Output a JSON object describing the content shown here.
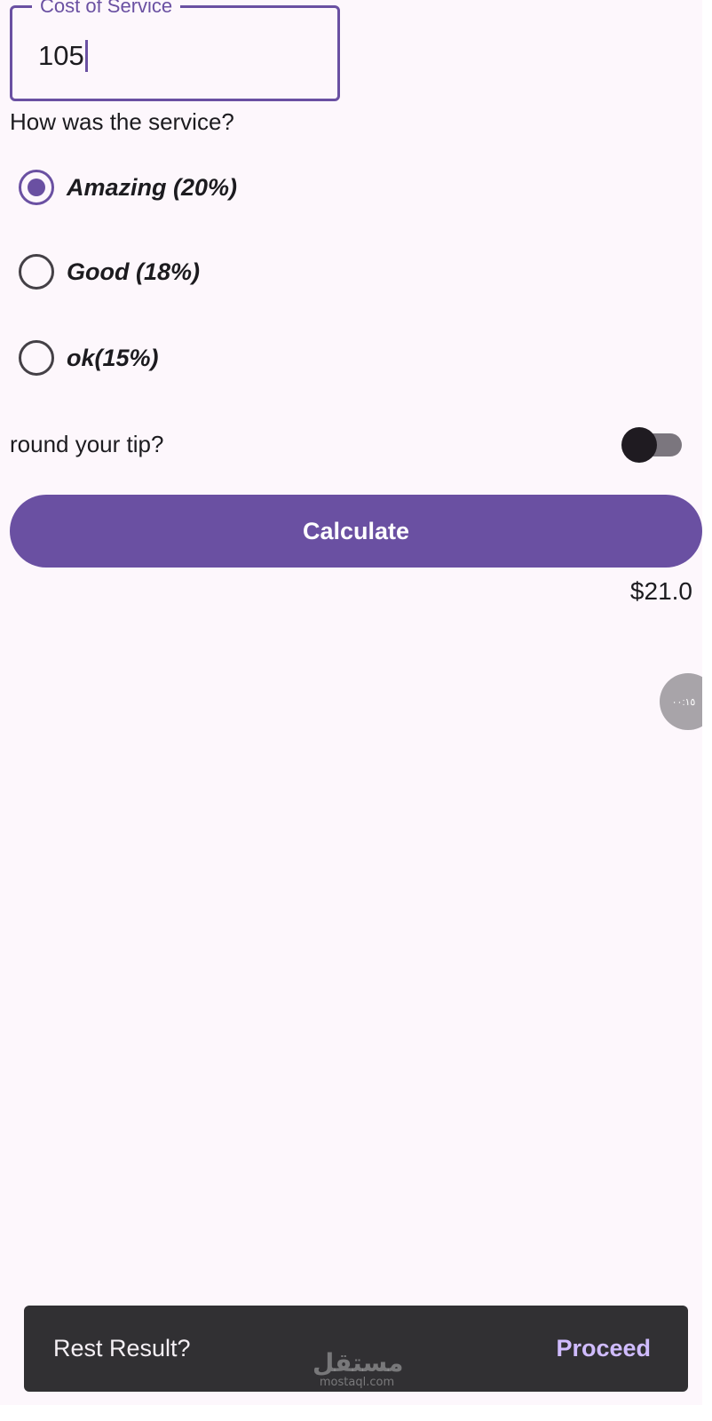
{
  "cost_field": {
    "label": "Cost of Service",
    "value": "105"
  },
  "question": "How was the service?",
  "options": [
    {
      "label": "Amazing (20%)",
      "selected": true
    },
    {
      "label": "Good (18%)",
      "selected": false
    },
    {
      "label": "ok(15%)",
      "selected": false
    }
  ],
  "round_tip": {
    "label": "round your tip?",
    "enabled": false
  },
  "calculate_button": "Calculate",
  "tip_result": "$21.0",
  "floating_bubble": "٠٠:١٥",
  "snackbar": {
    "message": "Rest Result?",
    "action": "Proceed"
  },
  "watermark": {
    "arabic": "مستقل",
    "latin": "mostaql.com"
  },
  "colors": {
    "primary": "#6a50a2",
    "background": "#fdf7fc",
    "snackbar": "#313033",
    "snackbar_action": "#d0bcff"
  }
}
